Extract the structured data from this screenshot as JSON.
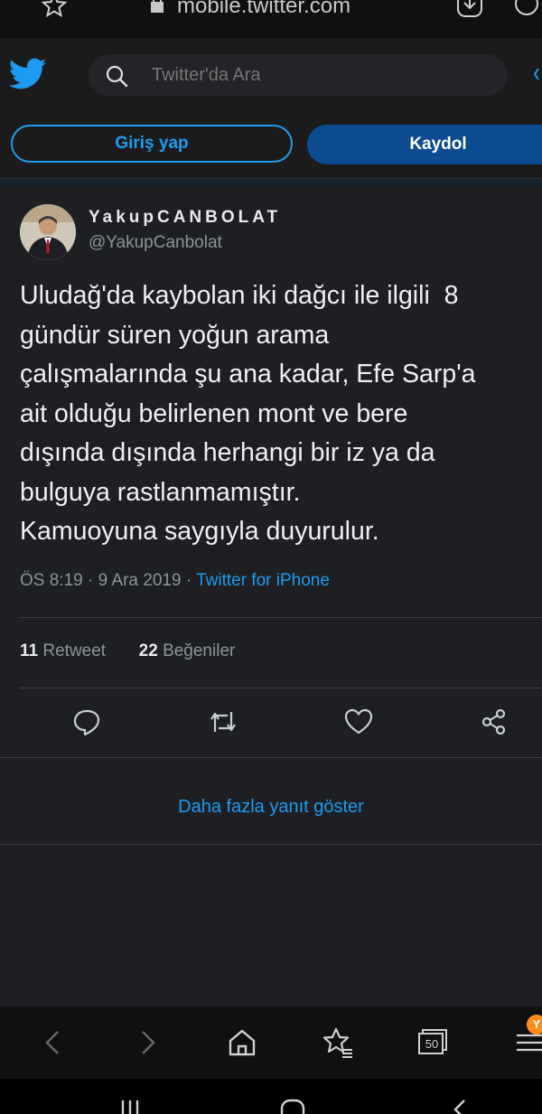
{
  "browser": {
    "url": "mobile.twitter.com"
  },
  "header": {
    "search_placeholder": "Twitter'da Ara"
  },
  "auth": {
    "login_label": "Giriş yap",
    "signup_label": "Kaydol"
  },
  "tweet": {
    "display_name": "YakupCANBOLAT",
    "handle": "@YakupCanbolat",
    "text": "Uludağ'da kaybolan iki dağcı ile ilgili  8\ngündür süren yoğun arama\nçalışmalarında şu ana kadar, Efe Sarp'a\nait olduğu belirlenen mont ve bere\ndışında dışında herhangi bir iz ya da\nbulguya rastlanmamıştır.\nKamuoyuna saygıyla duyurulur.",
    "time": "ÖS 8:19",
    "date": "9 Ara 2019",
    "separator": "·",
    "source": "Twitter for iPhone",
    "retweet_count": "11",
    "retweet_label": "Retweet",
    "like_count": "22",
    "like_label": "Beğeniler"
  },
  "more_replies_label": "Daha fazla yanıt göster",
  "browser_nav": {
    "tabs_count": "50",
    "badge": "Y"
  },
  "colors": {
    "accent": "#1d9bf0",
    "signup_bg": "#0d4c91",
    "tweet_bg": "#1d1f23",
    "header_bg": "#1b1b1b",
    "badge": "#ff8c1a"
  }
}
